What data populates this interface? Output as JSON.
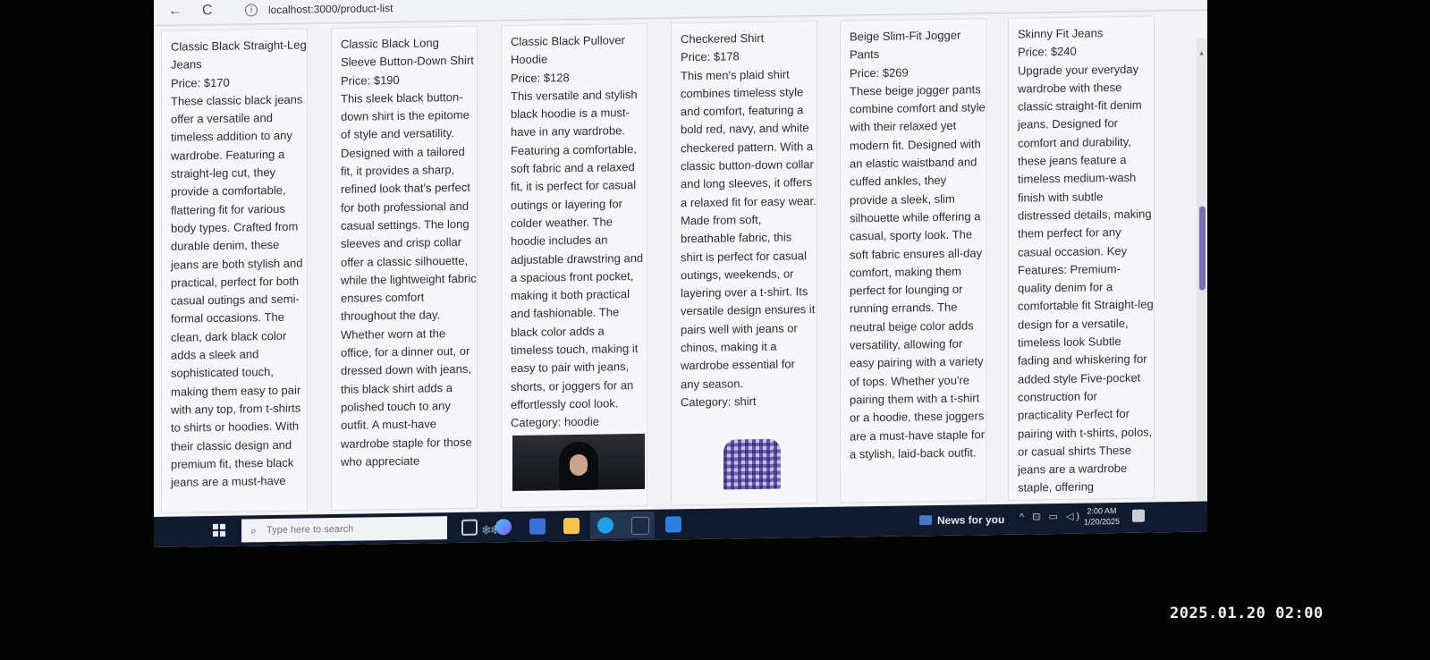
{
  "browser": {
    "back_icon": "←",
    "reload_icon": "C",
    "info_icon": "i",
    "url": "localhost:3000/product-list"
  },
  "products": [
    {
      "title": "Classic Black Straight-Leg Jeans",
      "price": "Price: $170",
      "description": "These classic black jeans offer a versatile and timeless addition to any wardrobe. Featuring a straight-leg cut, they provide a comfortable, flattering fit for various body types. Crafted from durable denim, these jeans are both stylish and practical, perfect for both casual outings and semi-formal occasions. The clean, dark black color adds a sleek and sophisticated touch, making them easy to pair with any top, from t-shirts to shirts or hoodies. With their classic design and premium fit, these black jeans are a must-have"
    },
    {
      "title": "Classic Black Long Sleeve Button-Down Shirt",
      "price": "Price: $190",
      "description": "This sleek black button-down shirt is the epitome of style and versatility. Designed with a tailored fit, it provides a sharp, refined look that's perfect for both professional and casual settings. The long sleeves and crisp collar offer a classic silhouette, while the lightweight fabric ensures comfort throughout the day. Whether worn at the office, for a dinner out, or dressed down with jeans, this black shirt adds a polished touch to any outfit. A must-have wardrobe staple for those who appreciate"
    },
    {
      "title": "Classic Black Pullover Hoodie",
      "price": "Price: $128",
      "description": "This versatile and stylish black hoodie is a must-have in any wardrobe. Featuring a comfortable, soft fabric and a relaxed fit, it is perfect for casual outings or layering for colder weather. The hoodie includes an adjustable drawstring and a spacious front pocket, making it both practical and fashionable. The black color adds a timeless touch, making it easy to pair with jeans, shorts, or joggers for an effortlessly cool look.",
      "category": "Category: hoodie"
    },
    {
      "title": "Checkered Shirt",
      "price": "Price: $178",
      "description": "This men's plaid shirt combines timeless style and comfort, featuring a bold red, navy, and white checkered pattern. With a classic button-down collar and long sleeves, it offers a relaxed fit for easy wear. Made from soft, breathable fabric, this shirt is perfect for casual outings, weekends, or layering over a t-shirt. Its versatile design ensures it pairs well with jeans or chinos, making it a wardrobe essential for any season.",
      "category": "Category: shirt"
    },
    {
      "title": "Beige Slim-Fit Jogger Pants",
      "price": "Price: $269",
      "description": "These beige jogger pants combine comfort and style with their relaxed yet modern fit. Designed with an elastic waistband and cuffed ankles, they provide a sleek, slim silhouette while offering a casual, sporty look. The soft fabric ensures all-day comfort, making them perfect for lounging or running errands. The neutral beige color adds versatility, allowing for easy pairing with a variety of tops. Whether you're pairing them with a t-shirt or a hoodie, these joggers are a must-have staple for a stylish, laid-back outfit."
    },
    {
      "title": "Skinny Fit Jeans",
      "price": "Price: $240",
      "description": "Upgrade your everyday wardrobe with these classic straight-fit denim jeans. Designed for comfort and durability, these jeans feature a timeless medium-wash finish with subtle distressed details, making them perfect for any casual occasion. Key Features: Premium-quality denim for a comfortable fit Straight-leg design for a versatile, timeless look Subtle fading and whiskering for added style Five-pocket construction for practicality Perfect for pairing with t-shirts, polos, or casual shirts These jeans are a wardrobe staple, offering"
    }
  ],
  "taskbar": {
    "start_icon": "windows-logo",
    "search_icon": "⌕",
    "search_placeholder": "Type here to search",
    "snow_glyphs": "❄❄",
    "news_label": "News for you",
    "tray_icons": "^ ⊡ ▭ ◁)",
    "time": "2:00 AM",
    "date": "1/20/2025"
  },
  "camera_timestamp": "2025.01.20 02:00",
  "colors": {
    "taskbar": "#101b2e",
    "scroll_thumb": "#7670b2",
    "text": "#2d2d30"
  }
}
